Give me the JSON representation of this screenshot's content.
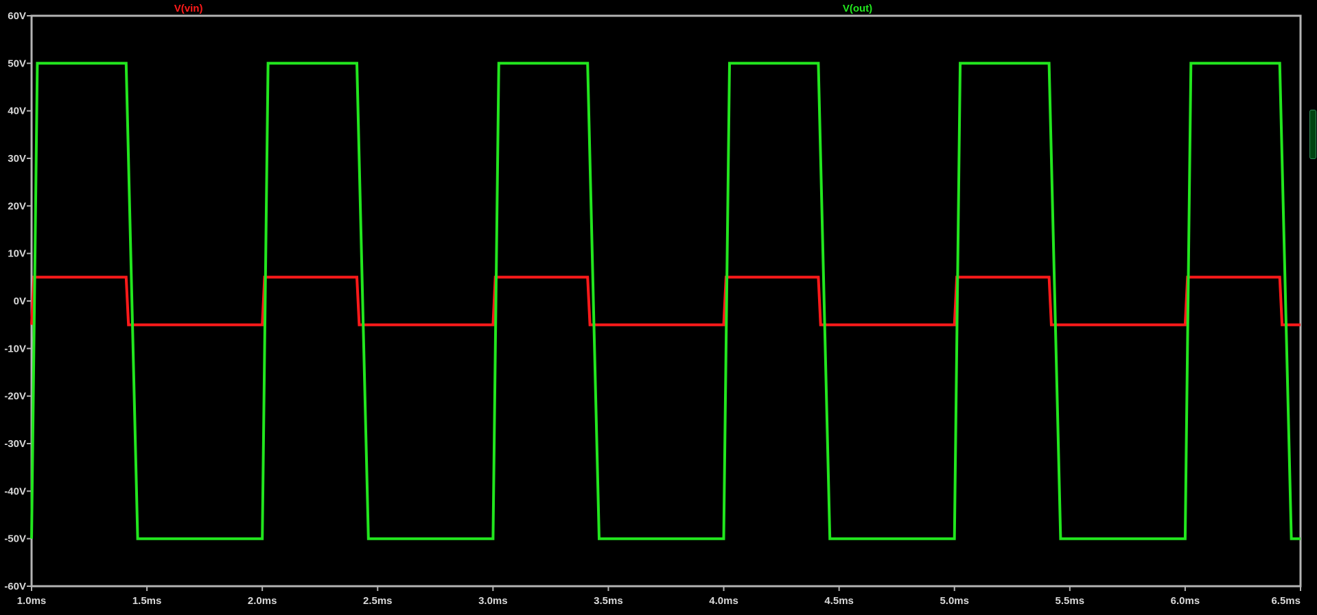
{
  "chart_data": {
    "type": "line",
    "title": "",
    "xlabel": "",
    "ylabel": "",
    "xlim": [
      1.0,
      6.5
    ],
    "ylim": [
      -60,
      60
    ],
    "grid": false,
    "x_ticks": [
      {
        "value": 1.0,
        "label": "1.0ms"
      },
      {
        "value": 1.5,
        "label": "1.5ms"
      },
      {
        "value": 2.0,
        "label": "2.0ms"
      },
      {
        "value": 2.5,
        "label": "2.5ms"
      },
      {
        "value": 3.0,
        "label": "3.0ms"
      },
      {
        "value": 3.5,
        "label": "3.5ms"
      },
      {
        "value": 4.0,
        "label": "4.0ms"
      },
      {
        "value": 4.5,
        "label": "4.5ms"
      },
      {
        "value": 5.0,
        "label": "5.0ms"
      },
      {
        "value": 5.5,
        "label": "5.5ms"
      },
      {
        "value": 6.0,
        "label": "6.0ms"
      },
      {
        "value": 6.5,
        "label": "6.5ms"
      }
    ],
    "y_ticks": [
      {
        "value": 60,
        "label": "60V"
      },
      {
        "value": 50,
        "label": "50V"
      },
      {
        "value": 40,
        "label": "40V"
      },
      {
        "value": 30,
        "label": "30V"
      },
      {
        "value": 20,
        "label": "20V"
      },
      {
        "value": 10,
        "label": "10V"
      },
      {
        "value": 0,
        "label": "0V"
      },
      {
        "value": -10,
        "label": "-10V"
      },
      {
        "value": -20,
        "label": "-20V"
      },
      {
        "value": -30,
        "label": "-30V"
      },
      {
        "value": -40,
        "label": "-40V"
      },
      {
        "value": -50,
        "label": "-50V"
      },
      {
        "value": -60,
        "label": "-60V"
      }
    ],
    "series": [
      {
        "name": "V(vin)",
        "color": "#ff1a1a",
        "points": [
          [
            1.0,
            -5
          ],
          [
            1.01,
            5
          ],
          [
            1.41,
            5
          ],
          [
            1.42,
            -5
          ],
          [
            2.0,
            -5
          ],
          [
            2.01,
            5
          ],
          [
            2.41,
            5
          ],
          [
            2.42,
            -5
          ],
          [
            3.0,
            -5
          ],
          [
            3.01,
            5
          ],
          [
            3.41,
            5
          ],
          [
            3.42,
            -5
          ],
          [
            4.0,
            -5
          ],
          [
            4.01,
            5
          ],
          [
            4.41,
            5
          ],
          [
            4.42,
            -5
          ],
          [
            5.0,
            -5
          ],
          [
            5.01,
            5
          ],
          [
            5.41,
            5
          ],
          [
            5.42,
            -5
          ],
          [
            6.0,
            -5
          ],
          [
            6.01,
            5
          ],
          [
            6.41,
            5
          ],
          [
            6.42,
            -5
          ],
          [
            6.5,
            -5
          ]
        ]
      },
      {
        "name": "V(out)",
        "color": "#22e61e",
        "points": [
          [
            1.0,
            -50
          ],
          [
            1.025,
            50
          ],
          [
            1.41,
            50
          ],
          [
            1.46,
            -50
          ],
          [
            2.0,
            -50
          ],
          [
            2.025,
            50
          ],
          [
            2.41,
            50
          ],
          [
            2.46,
            -50
          ],
          [
            3.0,
            -50
          ],
          [
            3.025,
            50
          ],
          [
            3.41,
            50
          ],
          [
            3.46,
            -50
          ],
          [
            4.0,
            -50
          ],
          [
            4.025,
            50
          ],
          [
            4.41,
            50
          ],
          [
            4.46,
            -50
          ],
          [
            5.0,
            -50
          ],
          [
            5.025,
            50
          ],
          [
            5.41,
            50
          ],
          [
            5.46,
            -50
          ],
          [
            6.0,
            -50
          ],
          [
            6.025,
            50
          ],
          [
            6.41,
            50
          ],
          [
            6.46,
            -50
          ],
          [
            6.5,
            -50
          ]
        ]
      }
    ]
  },
  "colors": {
    "background": "#000000",
    "frame": "#b4b4b4",
    "tick_text": "#d9d9d9"
  }
}
